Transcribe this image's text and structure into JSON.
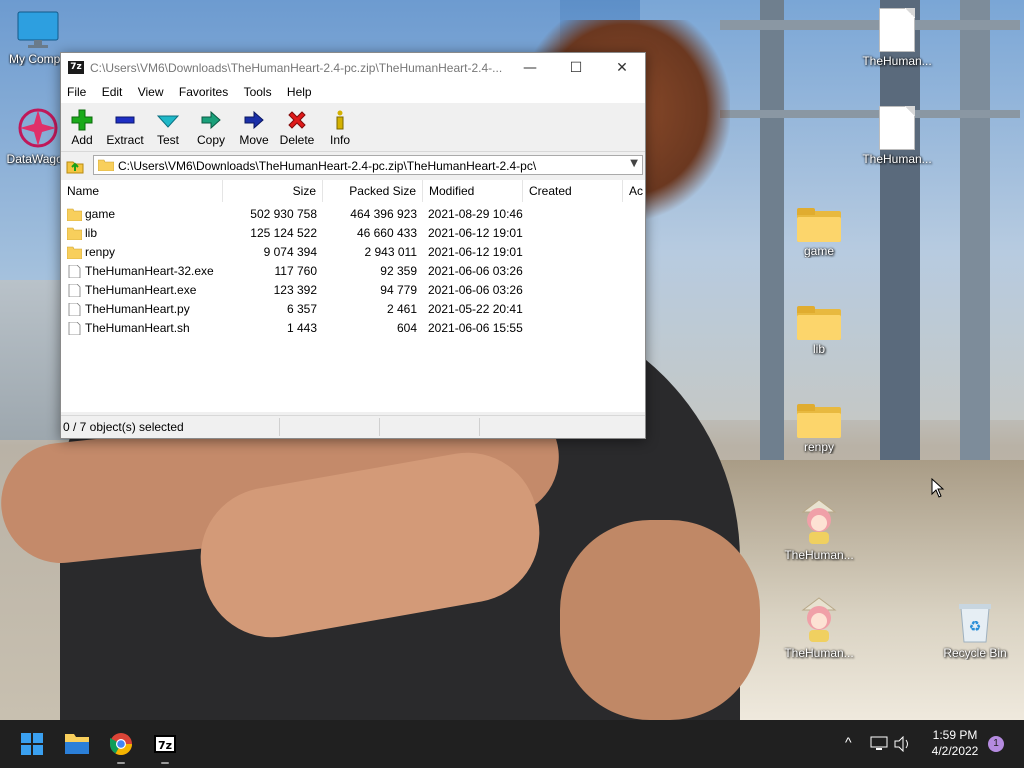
{
  "desktop": {
    "icons": [
      {
        "label": "My Compu",
        "icon": "monitor-icon"
      },
      {
        "label": "DataWagon",
        "icon": "datawagon-icon"
      },
      {
        "label": "TheHuman...",
        "icon": "file-icon"
      },
      {
        "label": "TheHuman...",
        "icon": "file-icon"
      },
      {
        "label": "game",
        "icon": "folder-icon"
      },
      {
        "label": "lib",
        "icon": "folder-icon"
      },
      {
        "label": "renpy",
        "icon": "folder-icon"
      },
      {
        "label": "TheHuman...",
        "icon": "anime-girl-app-icon"
      },
      {
        "label": "TheHuman...",
        "icon": "anime-girl-app-icon"
      },
      {
        "label": "Recycle Bin",
        "icon": "recycle-bin-icon"
      }
    ]
  },
  "window": {
    "app_icon_text": "7z",
    "title": "C:\\Users\\VM6\\Downloads\\TheHumanHeart-2.4-pc.zip\\TheHumanHeart-2.4-...",
    "controls": {
      "minimize": "—",
      "maximize": "☐",
      "close": "✕"
    },
    "menu": [
      "File",
      "Edit",
      "View",
      "Favorites",
      "Tools",
      "Help"
    ],
    "toolbar": [
      {
        "label": "Add",
        "icon": "add-plus-icon",
        "color": "#1aaa1a"
      },
      {
        "label": "Extract",
        "icon": "extract-minus-icon",
        "color": "#1e2fc4"
      },
      {
        "label": "Test",
        "icon": "test-checkmark-icon",
        "color": "#1fb8c8"
      },
      {
        "label": "Copy",
        "icon": "copy-arrow-icon",
        "color": "#1aa07a"
      },
      {
        "label": "Move",
        "icon": "move-arrow-icon",
        "color": "#1a2fa8"
      },
      {
        "label": "Delete",
        "icon": "delete-x-icon",
        "color": "#e01a1a"
      },
      {
        "label": "Info",
        "icon": "info-icon",
        "color": "#d4b100"
      }
    ],
    "address": "C:\\Users\\VM6\\Downloads\\TheHumanHeart-2.4-pc.zip\\TheHumanHeart-2.4-pc\\",
    "columns": [
      "Name",
      "Size",
      "Packed Size",
      "Modified",
      "Created",
      "Ac"
    ],
    "files": [
      {
        "name": "game",
        "type": "folder",
        "size": "502 930 758",
        "packed": "464 396 923",
        "modified": "2021-08-29 10:46"
      },
      {
        "name": "lib",
        "type": "folder",
        "size": "125 124 522",
        "packed": "46 660 433",
        "modified": "2021-06-12 19:01"
      },
      {
        "name": "renpy",
        "type": "folder",
        "size": "9 074 394",
        "packed": "2 943 011",
        "modified": "2021-06-12 19:01"
      },
      {
        "name": "TheHumanHeart-32.exe",
        "type": "file",
        "size": "117 760",
        "packed": "92 359",
        "modified": "2021-06-06 03:26"
      },
      {
        "name": "TheHumanHeart.exe",
        "type": "file",
        "size": "123 392",
        "packed": "94 779",
        "modified": "2021-06-06 03:26"
      },
      {
        "name": "TheHumanHeart.py",
        "type": "file",
        "size": "6 357",
        "packed": "2 461",
        "modified": "2021-05-22 20:41"
      },
      {
        "name": "TheHumanHeart.sh",
        "type": "file",
        "size": "1 443",
        "packed": "604",
        "modified": "2021-06-06 15:55"
      }
    ],
    "status": "0 / 7 object(s) selected"
  },
  "taskbar": {
    "apps": [
      "start-icon",
      "file-explorer-icon",
      "chrome-icon",
      "7zip-icon"
    ],
    "seven_zip_label": "7z",
    "time": "1:59 PM",
    "date": "4/2/2022",
    "notification_count": "1",
    "tray_chevron": "^"
  },
  "colors": {
    "taskbar_bg": "#202020",
    "folder": "#f8cf5c",
    "window_bg": "#f0f0f0"
  }
}
